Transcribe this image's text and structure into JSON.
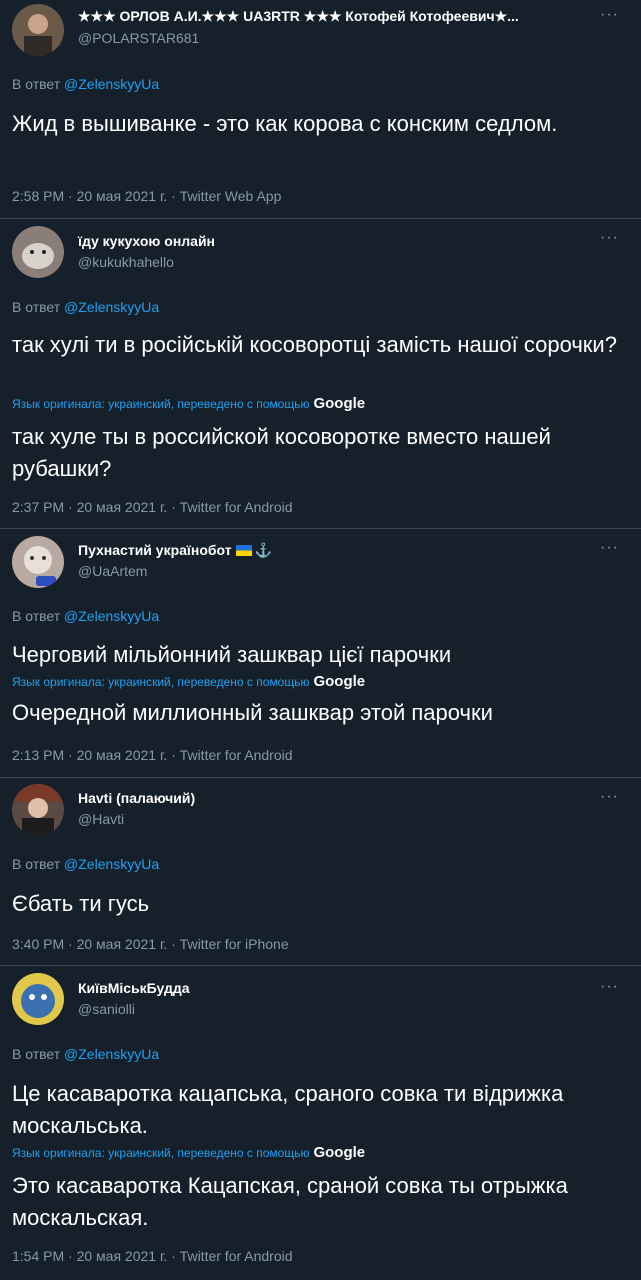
{
  "reply_prefix": "В ответ",
  "reply_to": "@ZelenskyyUa",
  "more": "···",
  "translation": {
    "label": "Язык оригинала: украинский, переведено с помощью",
    "brand": "Google"
  },
  "tweets": [
    {
      "name": "★★★ ОРЛОВ А.И.★★★ UA3RTR ★★★ Котофей Котофеевич★...",
      "handle": "@POLARSTAR681",
      "text": "Жид в вышиванке - это как корова с конским седлом.",
      "meta": "2:58 PM · 20 мая 2021 г. · Twitter Web App",
      "avatar_color": "#6b5a4a"
    },
    {
      "name": "їду кукухою онлайн",
      "handle": "@kukukhahello",
      "text": "так хулі ти в російській косоворотці замість нашої сорочки?",
      "translated": "так хуле ты в российской косоворотке вместо нашей рубашки?",
      "meta": "2:37 PM · 20 мая 2021 г. · Twitter for Android",
      "avatar_color": "#8a7f78"
    },
    {
      "name": "Пухнастий українобот",
      "handle": "@UaArtem",
      "text": "Черговий мільйонний зашквар цієї парочки",
      "translated": "Очередной миллионный зашквар этой парочки",
      "meta": "2:13 PM · 20 мая 2021 г. · Twitter for Android",
      "avatar_color": "#b8aaa0"
    },
    {
      "name": "Havti (палаючий)",
      "handle": "@Havti",
      "text": "Єбать ти гусь",
      "meta": "3:40 PM · 20 мая 2021 г. · Twitter for iPhone",
      "avatar_color": "#5a4a44"
    },
    {
      "name": "КиївМіськБудда",
      "handle": "@saniolli",
      "text": "Це касаваротка кацапська, сраного совка ти відрижка москальська.",
      "translated": "Это касаваротка Кацапская, сраной совка ты отрыжка москальская.",
      "meta": "1:54 PM · 20 мая 2021 г. · Twitter for Android",
      "avatar_color": "#3a6fb0"
    }
  ]
}
